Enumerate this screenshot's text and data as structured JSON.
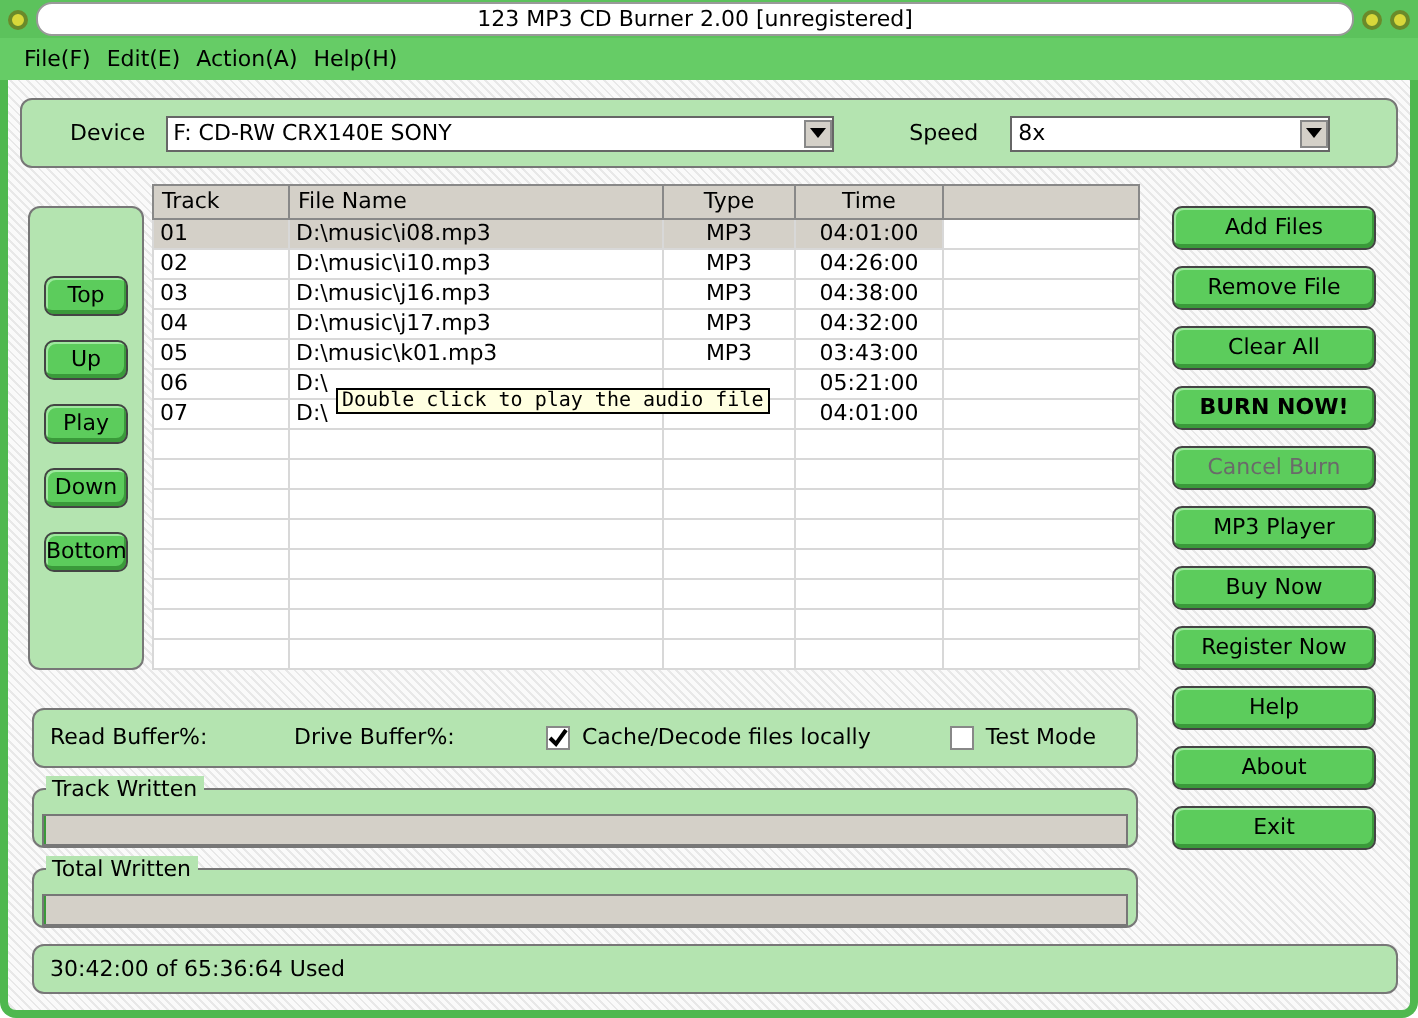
{
  "window": {
    "title": "123 MP3 CD Burner 2.00 [unregistered]"
  },
  "menu": [
    "File(F)",
    "Edit(E)",
    "Action(A)",
    "Help(H)"
  ],
  "device": {
    "label": "Device",
    "value": "F: CD-RW  CRX140E   SONY"
  },
  "speed": {
    "label": "Speed",
    "value": "8x"
  },
  "move_buttons": [
    "Top",
    "Up",
    "Play",
    "Down",
    "Bottom"
  ],
  "table": {
    "columns": [
      "Track",
      "File Name",
      "Type",
      "Time"
    ],
    "rows": [
      {
        "track": "01",
        "file": "D:\\music\\i08.mp3",
        "type": "MP3",
        "time": "04:01:00",
        "selected": true
      },
      {
        "track": "02",
        "file": "D:\\music\\i10.mp3",
        "type": "MP3",
        "time": "04:26:00",
        "selected": false
      },
      {
        "track": "03",
        "file": "D:\\music\\j16.mp3",
        "type": "MP3",
        "time": "04:38:00",
        "selected": false
      },
      {
        "track": "04",
        "file": "D:\\music\\j17.mp3",
        "type": "MP3",
        "time": "04:32:00",
        "selected": false
      },
      {
        "track": "05",
        "file": "D:\\music\\k01.mp3",
        "type": "MP3",
        "time": "03:43:00",
        "selected": false
      },
      {
        "track": "06",
        "file": "D:\\",
        "time": "05:21:00",
        "selected": false
      },
      {
        "track": "07",
        "file": "D:\\",
        "time": "04:01:00",
        "selected": false
      }
    ],
    "tooltip": "Double click to play the audio file"
  },
  "actions": [
    {
      "label": "Add Files",
      "bold": false,
      "disabled": false
    },
    {
      "label": "Remove File",
      "bold": false,
      "disabled": false
    },
    {
      "label": "Clear All",
      "bold": false,
      "disabled": false
    },
    {
      "label": "BURN NOW!",
      "bold": true,
      "disabled": false
    },
    {
      "label": "Cancel Burn",
      "bold": false,
      "disabled": true
    },
    {
      "label": "MP3 Player",
      "bold": false,
      "disabled": false
    },
    {
      "label": "Buy Now",
      "bold": false,
      "disabled": false
    },
    {
      "label": "Register Now",
      "bold": false,
      "disabled": false
    },
    {
      "label": "Help",
      "bold": false,
      "disabled": false
    },
    {
      "label": "About",
      "bold": false,
      "disabled": false
    },
    {
      "label": "Exit",
      "bold": false,
      "disabled": false
    }
  ],
  "buffers": {
    "read": "Read Buffer%:",
    "drive": "Drive Buffer%:"
  },
  "options": [
    {
      "label": "Cache/Decode files locally",
      "checked": true
    },
    {
      "label": "Test Mode",
      "checked": false
    }
  ],
  "progress": [
    {
      "label": "Track Written",
      "level": 0
    },
    {
      "label": "Total Written",
      "level": 0
    }
  ],
  "status_bar": "30:42:00 of 65:36:64 Used"
}
